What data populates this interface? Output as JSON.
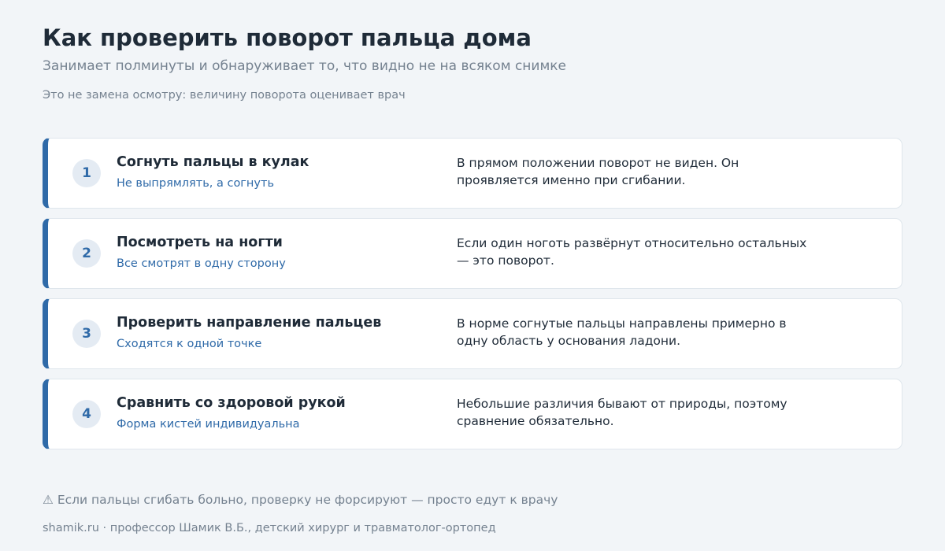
{
  "header": {
    "title": "Как проверить поворот пальца дома",
    "subtitle": "Занимает полминуты и обнаруживает то, что видно не на всяком снимке",
    "disclaimer": "Это не замена осмотру: величину поворота оценивает врач"
  },
  "steps": [
    {
      "number": "1",
      "title": "Согнуть пальцы в кулак",
      "hint": "Не выпрямлять, а согнуть",
      "description": "В прямом положении поворот не виден. Он проявляется именно при сгибании."
    },
    {
      "number": "2",
      "title": "Посмотреть на ногти",
      "hint": "Все смотрят в одну сторону",
      "description": "Если один ноготь развёрнут относительно остальных — это поворот."
    },
    {
      "number": "3",
      "title": "Проверить направление пальцев",
      "hint": "Сходятся к одной точке",
      "description": "В норме согнутые пальцы направлены примерно в одну область у основания ладони."
    },
    {
      "number": "4",
      "title": "Сравнить со здоровой рукой",
      "hint": "Форма кистей индивидуальна",
      "description": "Небольшие различия бывают от природы, поэтому сравнение обязательно."
    }
  ],
  "warning": "⚠ Если пальцы сгибать больно, проверку не форсируют — просто едут к врачу",
  "footer": "shamik.ru · профессор Шамик В.Б., детский хирург и травматолог-ортопед",
  "colors": {
    "accent": "#2f6aa8",
    "background": "#f2f5f8",
    "card": "#ffffff",
    "text": "#1f2b38",
    "muted": "#758290"
  }
}
